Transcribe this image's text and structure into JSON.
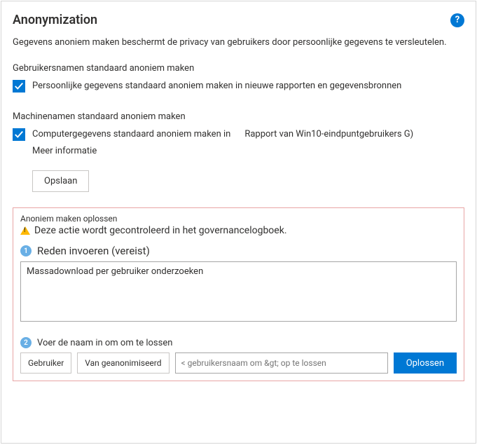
{
  "header": {
    "title": "Anonymization",
    "help_glyph": "?"
  },
  "description": "Gegevens anoniem maken beschermt de privacy van gebruikers door persoonlijke gegevens te versleutelen.",
  "usernames_section": {
    "label": "Gebruikersnamen standaard anoniem maken",
    "checkbox_text": "Persoonlijke gegevens standaard anoniem maken in nieuwe rapporten en gegevensbronnen"
  },
  "machines_section": {
    "label": "Machinenamen standaard anoniem maken",
    "checkbox_text": "Computergegevens standaard anoniem maken in",
    "report_name": "Rapport van Win10-eindpuntgebruikers G)",
    "more_info": "Meer informatie"
  },
  "save_label": "Opslaan",
  "resolve": {
    "title": "Anoniem maken oplossen",
    "warning": "Deze actie wordt gecontroleerd in het governancelogboek.",
    "step1_label": "Reden invoeren (vereist)",
    "reason_value": "Massadownload per gebruiker onderzoeken",
    "step2_label": "Voer de naam in om om te lossen",
    "user_btn": "Gebruiker",
    "from_anon_btn": "Van geanonimiseerd",
    "name_placeholder": "< gebruikersnaam om &gt; op te lossen",
    "resolve_btn": "Oplossen"
  }
}
